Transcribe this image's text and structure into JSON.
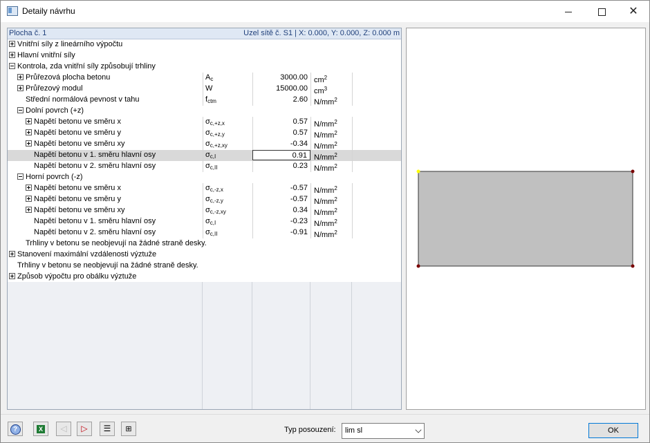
{
  "window": {
    "title": "Detaily návrhu"
  },
  "grid": {
    "header_left": "Plocha č. 1",
    "header_right": "Uzel sítě č. S1  |  X: 0.000, Y: 0.000, Z: 0.000 m",
    "rows": [
      {
        "indent": 0,
        "toggle": "plus",
        "name": "Vnitřní síly z lineárního výpočtu",
        "full": true
      },
      {
        "indent": 0,
        "toggle": "plus",
        "name": "Hlavní vnitřní síly",
        "full": true
      },
      {
        "indent": 0,
        "toggle": "minus",
        "name": "Kontrola, zda vnitřní síly způsobují trhliny",
        "full": true
      },
      {
        "indent": 1,
        "toggle": "plus",
        "name": "Průřezová plocha betonu",
        "sym": "A",
        "sub": "c",
        "value": "3000.00",
        "unit": "cm",
        "sup": "2"
      },
      {
        "indent": 1,
        "toggle": "plus",
        "name": "Průřezový modul",
        "sym": "W",
        "sub": "",
        "value": "15000.00",
        "unit": "cm",
        "sup": "3"
      },
      {
        "indent": 1,
        "toggle": "",
        "name": "Střední normálová pevnost v tahu",
        "sym": "f",
        "sub": "ctm",
        "value": "2.60",
        "unit": "N/mm",
        "sup": "2"
      },
      {
        "indent": 1,
        "toggle": "minus",
        "name": "Dolní povrch (+z)",
        "full": true
      },
      {
        "indent": 2,
        "toggle": "plus",
        "name": "Napětí betonu ve směru x",
        "sym": "σ",
        "sub": "c,+z,x",
        "value": "0.57",
        "unit": "N/mm",
        "sup": "2"
      },
      {
        "indent": 2,
        "toggle": "plus",
        "name": "Napětí betonu ve směru y",
        "sym": "σ",
        "sub": "c,+z,y",
        "value": "0.57",
        "unit": "N/mm",
        "sup": "2"
      },
      {
        "indent": 2,
        "toggle": "plus",
        "name": "Napětí betonu ve směru xy",
        "sym": "σ",
        "sub": "c,+z,xy",
        "value": "-0.34",
        "unit": "N/mm",
        "sup": "2"
      },
      {
        "indent": 2,
        "toggle": "",
        "name": "Napětí betonu v 1. směru hlavní osy",
        "sym": "σ",
        "sub": "c,I",
        "value": "0.91",
        "unit": "N/mm",
        "sup": "2",
        "selected": true
      },
      {
        "indent": 2,
        "toggle": "",
        "name": "Napětí betonu v 2. směru hlavní osy",
        "sym": "σ",
        "sub": "c,II",
        "value": "0.23",
        "unit": "N/mm",
        "sup": "2"
      },
      {
        "indent": 1,
        "toggle": "minus",
        "name": "Horní povrch (-z)",
        "full": true
      },
      {
        "indent": 2,
        "toggle": "plus",
        "name": "Napětí betonu ve směru x",
        "sym": "σ",
        "sub": "c,-z,x",
        "value": "-0.57",
        "unit": "N/mm",
        "sup": "2"
      },
      {
        "indent": 2,
        "toggle": "plus",
        "name": "Napětí betonu ve směru y",
        "sym": "σ",
        "sub": "c,-z,y",
        "value": "-0.57",
        "unit": "N/mm",
        "sup": "2"
      },
      {
        "indent": 2,
        "toggle": "plus",
        "name": "Napětí betonu ve směru xy",
        "sym": "σ",
        "sub": "c,-z,xy",
        "value": "0.34",
        "unit": "N/mm",
        "sup": "2"
      },
      {
        "indent": 2,
        "toggle": "",
        "name": "Napětí betonu v 1. směru hlavní osy",
        "sym": "σ",
        "sub": "c,I",
        "value": "-0.23",
        "unit": "N/mm",
        "sup": "2"
      },
      {
        "indent": 2,
        "toggle": "",
        "name": "Napětí betonu v 2. směru hlavní osy",
        "sym": "σ",
        "sub": "c,II",
        "value": "-0.91",
        "unit": "N/mm",
        "sup": "2"
      },
      {
        "indent": 1,
        "toggle": "",
        "name": "Trhliny v betonu se neobjevují na žádné straně desky.",
        "full": true
      },
      {
        "indent": 0,
        "toggle": "plus",
        "name": "Stanovení maximální vzdálenosti výztuže",
        "full": true
      },
      {
        "indent": 0,
        "toggle": "",
        "name": "Trhliny v betonu se neobjevují na žádné straně desky.",
        "full": true
      },
      {
        "indent": 0,
        "toggle": "plus",
        "name": "Způsob výpočtu pro obálku výztuže",
        "full": true
      }
    ]
  },
  "preview": {
    "fill": "#c0c0c0",
    "stroke": "#333333",
    "corner_color": "#7a0000",
    "origin_color": "#ffff00"
  },
  "footer": {
    "typ_label": "Typ posouzení:",
    "typ_value": "lim sl",
    "ok_label": "OK",
    "icons": [
      "help-icon",
      "excel-icon",
      "prev-icon",
      "next-icon",
      "list-icon",
      "tree-icon"
    ]
  }
}
